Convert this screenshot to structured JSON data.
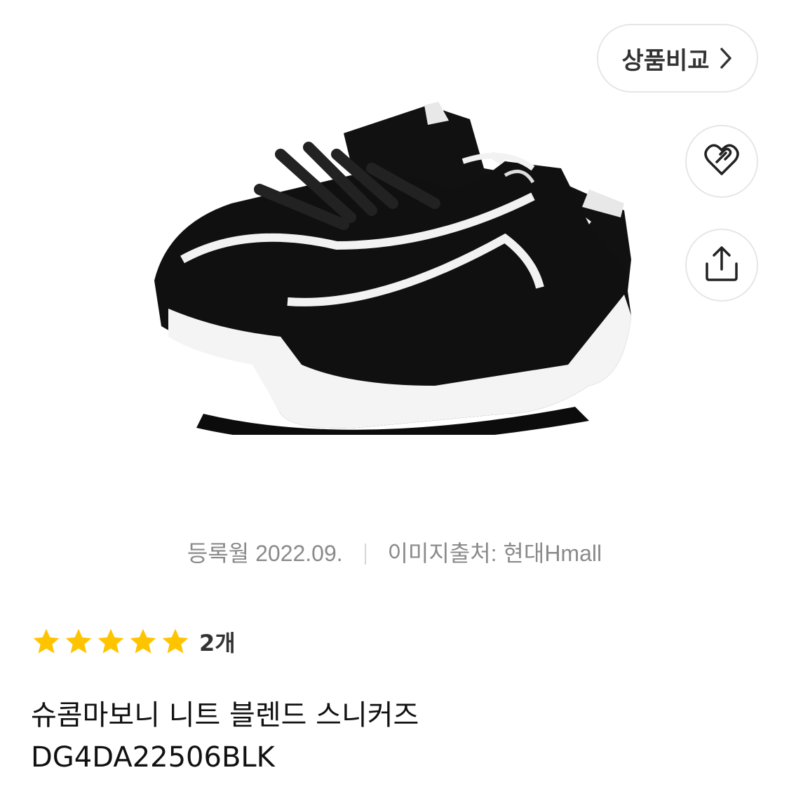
{
  "toolbar": {
    "compare_label": "상품비교",
    "wish_icon": "heart-link-icon",
    "share_icon": "share-icon"
  },
  "product": {
    "image_alt": "black knit sneakers",
    "registered": "등록월 2022.09.",
    "image_source": "이미지출처: 현대Hmall",
    "rating": {
      "stars": 5,
      "max": 5,
      "count_label": "2개"
    },
    "title_line1": "슈콤마보니 니트 블렌드 스니커즈",
    "title_line2": "DG4DA22506BLK"
  },
  "colors": {
    "star": "#FFC400",
    "border": "#E6E6E6",
    "muted": "#8A8A8A"
  }
}
